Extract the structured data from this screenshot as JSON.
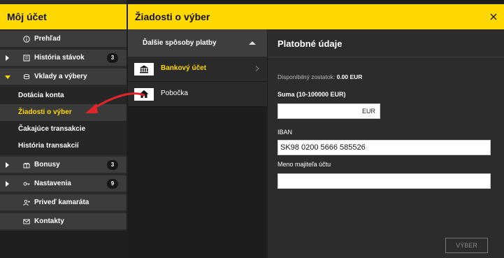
{
  "sidebar": {
    "title": "Môj účet",
    "items": [
      {
        "label": "Prehľad",
        "icon": "info-circle-icon"
      },
      {
        "label": "História stávok",
        "icon": "history-list-icon",
        "badge": "3"
      },
      {
        "label": "Vklady a výbery",
        "icon": "coins-icon"
      },
      {
        "label": "Bonusy",
        "icon": "gift-icon",
        "badge": "3"
      },
      {
        "label": "Nastavenia",
        "icon": "key-icon",
        "badge": "9"
      },
      {
        "label": "Priveď kamaráta",
        "icon": "user-add-icon"
      },
      {
        "label": "Kontakty",
        "icon": "envelope-icon"
      }
    ],
    "subitems": [
      {
        "label": "Dotácia konta"
      },
      {
        "label": "Žiadosti o výber"
      },
      {
        "label": "Čakajúce transakcie"
      },
      {
        "label": "História transakcií"
      }
    ]
  },
  "main": {
    "title": "Žiadosti o výber"
  },
  "methods": {
    "header": "Ďalšie spôsoby platby",
    "items": [
      {
        "label": "Bankový účet",
        "icon": "bank-icon"
      },
      {
        "label": "Pobočka",
        "icon": "branch-house-icon"
      }
    ]
  },
  "details": {
    "title": "Platobné údaje",
    "balance_label": "Disponibilný zostatok:",
    "balance_value": "0.00 EUR",
    "amount_label": "Suma (10-100000 EUR)",
    "amount_value": "",
    "amount_currency": "EUR",
    "iban_label": "IBAN",
    "iban_value": "SK98 0200 5666 585526",
    "owner_label": "Meno majiteľa účtu",
    "owner_value": "",
    "submit_label": "VÝBER"
  },
  "colors": {
    "accent": "#ffd800",
    "annotation_arrow": "#e0262b"
  }
}
